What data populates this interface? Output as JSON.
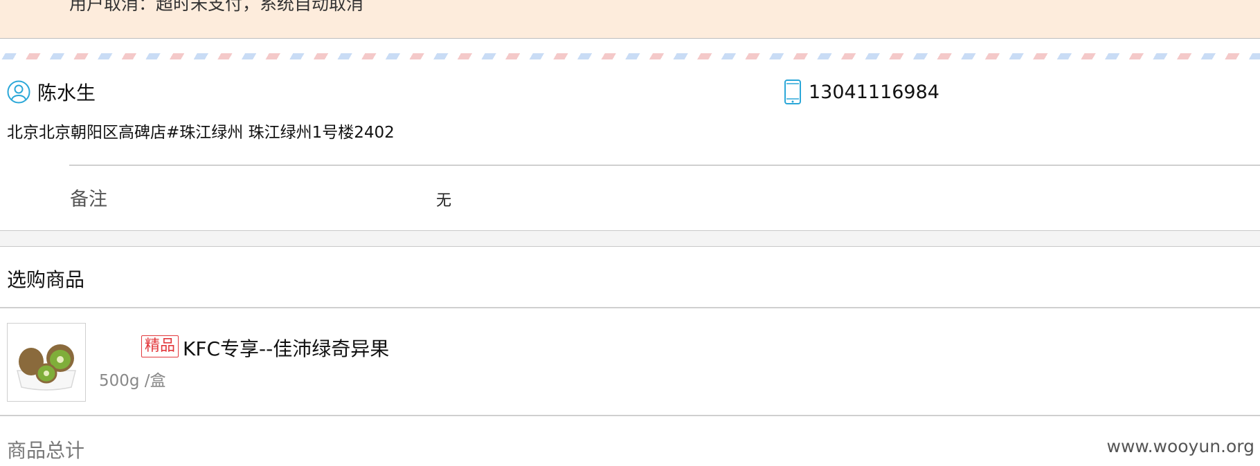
{
  "notice": {
    "text": "用户取消：超时未支付，系统自动取消"
  },
  "contact": {
    "name": "陈水生",
    "phone": "13041116984",
    "address": "北京北京朝阳区高碑店#珠江绿州 珠江绿州1号楼2402",
    "user_icon": "user-circle-icon",
    "phone_icon": "mobile-phone-icon"
  },
  "remark": {
    "label": "备注",
    "value": "无"
  },
  "products_section": {
    "title": "选购商品",
    "items": [
      {
        "tag": "精品",
        "name": "KFC专享--佳沛绿奇异果",
        "spec": "500g /盒",
        "image": "kiwi-fruit-image"
      }
    ]
  },
  "summary": {
    "total_label": "商品总计"
  },
  "watermark": "www.wooyun.org",
  "colors": {
    "notice_bg": "#fdecdc",
    "accent_icon": "#2aa7d8",
    "tag_red": "#e2373b"
  }
}
